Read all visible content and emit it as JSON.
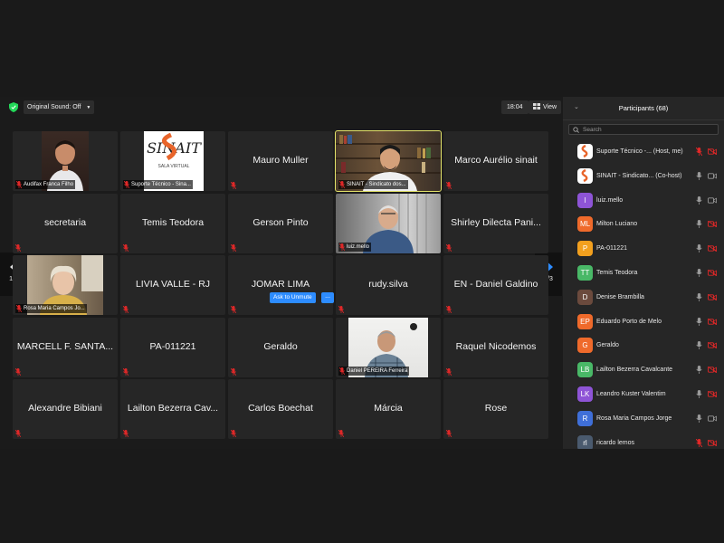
{
  "toolbar": {
    "sound_label": "Original Sound: Off",
    "time": "18:04",
    "view_label": "View",
    "colors": {
      "secure": "#23d959",
      "muted": "#e02828",
      "accent": "#2d8cff",
      "active_speaker": "#e3e36a"
    }
  },
  "gallery": {
    "page_indicator_left": "1/3",
    "page_indicator_right": "1/3",
    "ask_unmute_label": "Ask to Unmute",
    "ask_more_label": "...",
    "tiles": [
      {
        "name": "Audifax Franca Filho",
        "video": true
      },
      {
        "name": "Suporte Técnico - Sina...",
        "video": true
      },
      {
        "name": "Mauro Muller",
        "video": false
      },
      {
        "name": "SINAIT - Sindicato dos...",
        "video": true,
        "active": true
      },
      {
        "name": "Marco Aurélio sinait",
        "video": false
      },
      {
        "name": "secretaria",
        "video": false
      },
      {
        "name": "Temis Teodora",
        "video": false
      },
      {
        "name": "Gerson Pinto",
        "video": false
      },
      {
        "name": "luiz.mello",
        "video": true
      },
      {
        "name": "Shirley Dilecta Pani...",
        "video": false
      },
      {
        "name": "Rosa Maria Campos Jo...",
        "video": true
      },
      {
        "name": "LIVIA VALLE - RJ",
        "video": false
      },
      {
        "name": "JOMAR LIMA",
        "video": false
      },
      {
        "name": "rudy.silva",
        "video": false
      },
      {
        "name": "EN - Daniel Galdino",
        "video": false
      },
      {
        "name": "MARCELL F. SANTA...",
        "video": false
      },
      {
        "name": "PA-011221",
        "video": false
      },
      {
        "name": "Geraldo",
        "video": false
      },
      {
        "name": "Daniel PEREIRA Ferreira",
        "video": true
      },
      {
        "name": "Raquel Nicodemos",
        "video": false
      },
      {
        "name": "Alexandre Bibiani",
        "video": false
      },
      {
        "name": "Lailton Bezerra Cav...",
        "video": false
      },
      {
        "name": "Carlos Boechat",
        "video": false
      },
      {
        "name": "Márcia",
        "video": false
      },
      {
        "name": "Rose",
        "video": false
      }
    ],
    "logo_text": "SINAIT",
    "logo_subtext": "SALA VIRTUAL"
  },
  "participants": {
    "title": "Participants (68)",
    "search_placeholder": "Search",
    "list": [
      {
        "name": "Suporte Técnico -...",
        "role": "(Host, me)",
        "avatar": "logo",
        "color": "#ffffff",
        "mic": "muted",
        "cam": "off"
      },
      {
        "name": "SINAIT - Sindicato...",
        "role": "(Co-host)",
        "avatar": "logo",
        "color": "#ffffff",
        "mic": "on",
        "cam": "on"
      },
      {
        "name": "luiz.mello",
        "role": "",
        "avatar": "l",
        "color": "#8e54d6",
        "mic": "on",
        "cam": "on"
      },
      {
        "name": "Milton Luciano",
        "role": "",
        "avatar": "ML",
        "color": "#ef6a2b",
        "mic": "on",
        "cam": "off"
      },
      {
        "name": "PA-011221",
        "role": "",
        "avatar": "P",
        "color": "#f2a01e",
        "mic": "on",
        "cam": "off"
      },
      {
        "name": "Temis Teodora",
        "role": "",
        "avatar": "TT",
        "color": "#49b867",
        "mic": "on",
        "cam": "off"
      },
      {
        "name": "Denise Brambilla",
        "role": "",
        "avatar": "D",
        "color": "#6b4a3d",
        "mic": "on",
        "cam": "off"
      },
      {
        "name": "Eduardo Porto de Melo",
        "role": "",
        "avatar": "EP",
        "color": "#ef6a2b",
        "mic": "on",
        "cam": "off"
      },
      {
        "name": "Geraldo",
        "role": "",
        "avatar": "G",
        "color": "#ef6a2b",
        "mic": "on",
        "cam": "off"
      },
      {
        "name": "Lailton Bezerra Cavalcante",
        "role": "",
        "avatar": "LB",
        "color": "#49b867",
        "mic": "on",
        "cam": "off"
      },
      {
        "name": "Leandro Kuster Valentim",
        "role": "",
        "avatar": "LK",
        "color": "#8e54d6",
        "mic": "on",
        "cam": "off"
      },
      {
        "name": "Rosa Maria Campos Jorge",
        "role": "",
        "avatar": "R",
        "color": "#3f6fd8",
        "mic": "on",
        "cam": "on"
      },
      {
        "name": "ricardo lemos",
        "role": "",
        "avatar": "rl",
        "color": "#4a5a6e",
        "mic": "muted",
        "cam": "off"
      }
    ]
  }
}
